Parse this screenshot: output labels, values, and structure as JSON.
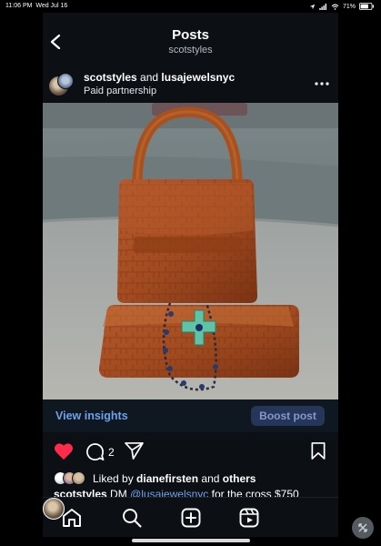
{
  "status_bar": {
    "time": "11:06 PM",
    "date": "Wed Jul 16",
    "battery": "71%"
  },
  "header": {
    "title": "Posts",
    "subtitle": "scotstyles"
  },
  "post": {
    "author": "scotstyles",
    "connector": "and",
    "collaborator": "lusajewelsnyc",
    "partnership": "Paid partnership"
  },
  "insights": {
    "link": "View insights",
    "boost": "Boost post"
  },
  "actions": {
    "comment_count": "2"
  },
  "likes": {
    "prefix": "Liked by",
    "user": "dianefirsten",
    "connector": "and",
    "others": "others"
  },
  "caption": {
    "user": "scotstyles",
    "text_before": "DM",
    "mention": "@lusajewelsnyc",
    "text_after": "for the cross $750"
  },
  "colors": {
    "accent": "#6ea1ec",
    "heart": "#ff2b4a",
    "boost_bg": "#26355a",
    "background": "#0c1015"
  },
  "icons": [
    "back-icon",
    "more-icon",
    "heart-icon",
    "comment-icon",
    "share-icon",
    "save-icon",
    "home-icon",
    "search-icon",
    "create-icon",
    "reels-icon",
    "assistive-touch-icon"
  ]
}
